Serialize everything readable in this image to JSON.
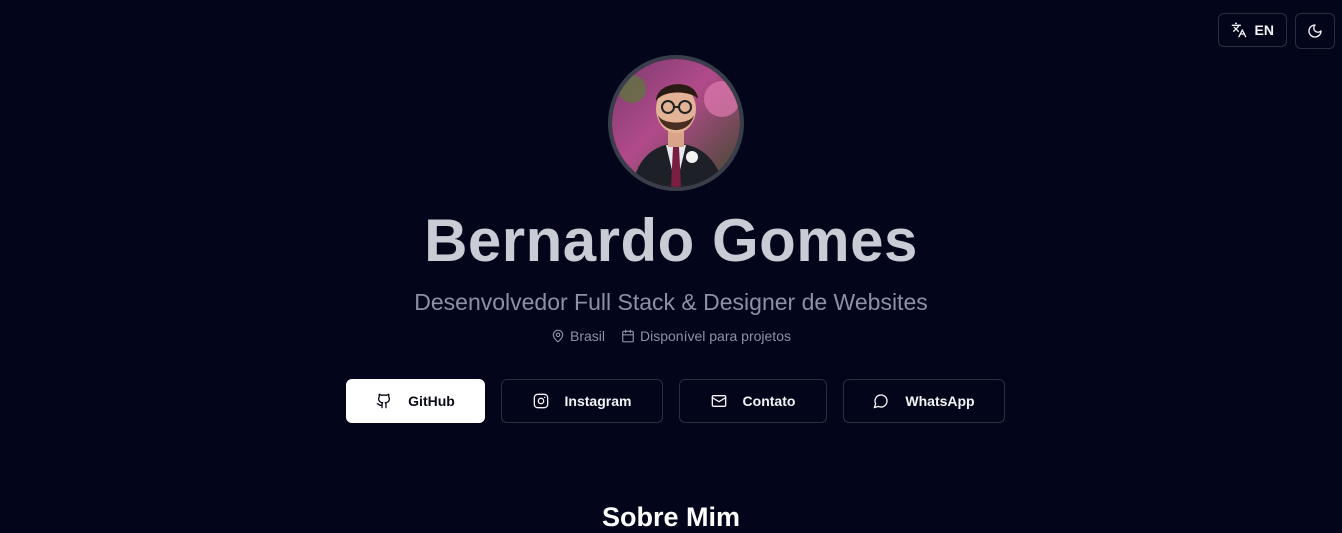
{
  "header": {
    "language_label": "EN",
    "icons": {
      "language": "translate-icon",
      "theme": "moon-icon"
    }
  },
  "profile": {
    "name": "Bernardo Gomes",
    "role": "Desenvolvedor Full Stack & Designer de Websites",
    "location": "Brasil",
    "availability": "Disponível para projetos",
    "avatar_alt": "Bernardo Gomes"
  },
  "links": [
    {
      "label": "GitHub",
      "icon": "github-icon"
    },
    {
      "label": "Instagram",
      "icon": "instagram-icon"
    },
    {
      "label": "Contato",
      "icon": "mail-icon"
    },
    {
      "label": "WhatsApp",
      "icon": "message-circle-icon"
    }
  ],
  "about": {
    "title": "Sobre Mim"
  },
  "colors": {
    "background": "#03061a",
    "primary_button": "#ffffff",
    "muted_text": "#8b92a6",
    "name_text": "#c9ccd4"
  }
}
